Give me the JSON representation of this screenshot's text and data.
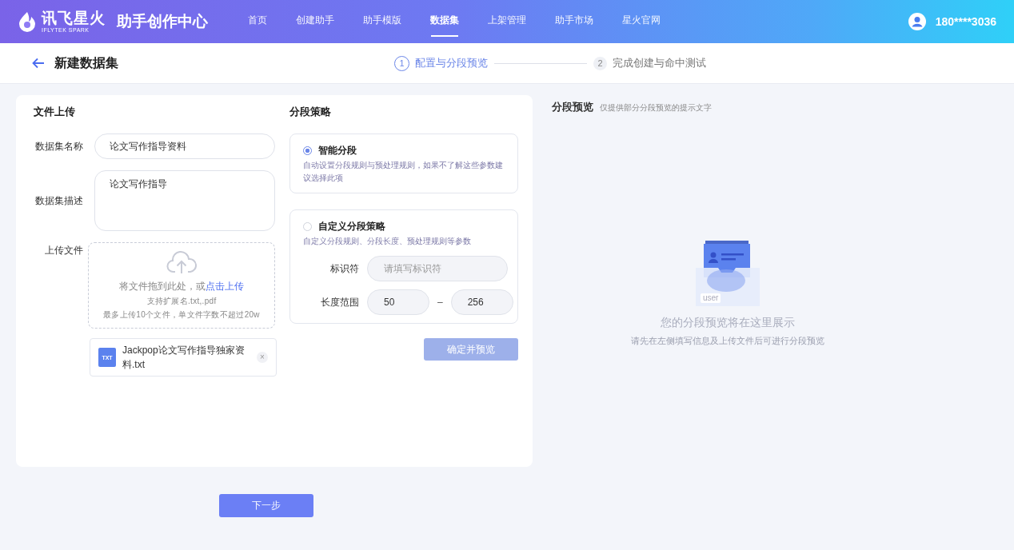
{
  "header": {
    "logo_text": "讯飞星火",
    "logo_subtext": "IFLYTEK SPARK",
    "app_title": "助手创作中心",
    "nav": [
      {
        "label": "首页",
        "selected": false
      },
      {
        "label": "创建助手",
        "selected": false
      },
      {
        "label": "助手模版",
        "selected": false
      },
      {
        "label": "数据集",
        "selected": true
      },
      {
        "label": "上架管理",
        "selected": false
      },
      {
        "label": "助手市场",
        "selected": false
      },
      {
        "label": "星火官网",
        "selected": false
      }
    ],
    "user": "180****3036"
  },
  "page_title": "新建数据集",
  "steps": [
    {
      "number": "1",
      "label": "配置与分段预览",
      "selected": true
    },
    {
      "number": "2",
      "label": "完成创建与命中测试",
      "selected": false
    }
  ],
  "upload_section": {
    "title": "文件上传",
    "name_field": {
      "label": "数据集名称",
      "value": "论文写作指导资料"
    },
    "description_field": {
      "label": "数据集描述",
      "value": "论文写作指导"
    },
    "upload": {
      "label": "上传文件",
      "hint": "将文件拖到此处，或",
      "link": "点击上传",
      "extensions": "支持扩展名.txt,.pdf",
      "limit": "最多上传10个文件，单文件字数不超过20w"
    },
    "files": [
      {
        "type": "TXT",
        "name": "Jackpop论文写作指导独家资料.txt",
        "remove": "×"
      }
    ]
  },
  "strategy_section": {
    "title": "分段策略",
    "options": [
      {
        "title": "智能分段",
        "description": "自动设置分段规则与预处理规则，如果不了解这些参数建议选择此项",
        "selected": true
      },
      {
        "title": "自定义分段策略",
        "description": "自定义分段规则、分段长度、预处理规则等参数",
        "selected": false
      }
    ],
    "identifier": {
      "label": "标识符",
      "placeholder": "请填写标识符"
    },
    "length_range": {
      "label": "长度范围",
      "min": "50",
      "separator": "–",
      "max": "256"
    },
    "confirm_button": "确定并预览"
  },
  "preview": {
    "title": "分段预览",
    "subtitle": "仅提供部分分段预览的提示文字",
    "illustration_tag": "user",
    "empty_title": "您的分段预览将在这里展示",
    "empty_hint": "请先在左侧填写信息及上传文件后可进行分段预览"
  },
  "next_button": "下一步"
}
